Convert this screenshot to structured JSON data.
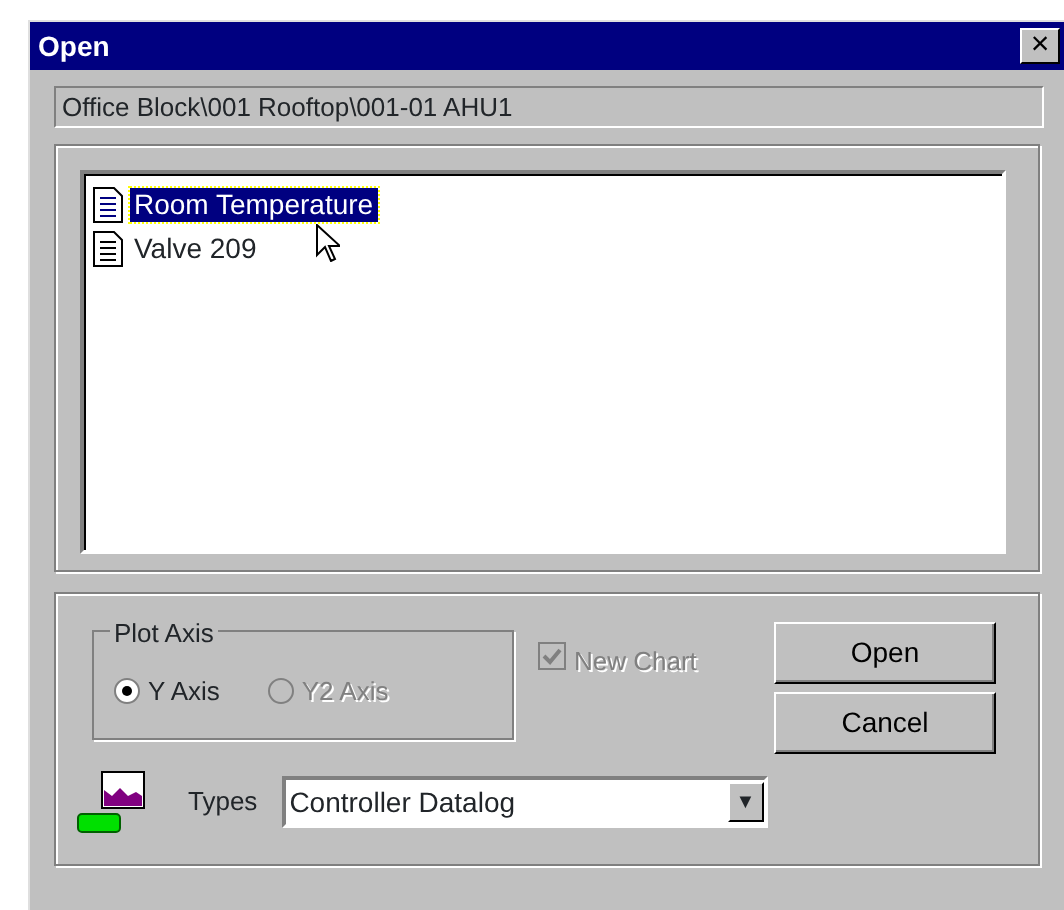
{
  "window": {
    "title": "Open",
    "close": "×"
  },
  "path": "Office Block\\001 Rooftop\\001-01 AHU1",
  "items": [
    {
      "label": "Room Temperature",
      "selected": true
    },
    {
      "label": "Valve 209",
      "selected": false
    }
  ],
  "plot_axis": {
    "title": "Plot Axis",
    "options": [
      {
        "label": "Y Axis",
        "selected": true,
        "disabled": false
      },
      {
        "label": "Y2 Axis",
        "selected": false,
        "disabled": true
      }
    ]
  },
  "new_chart": {
    "label": "New Chart",
    "checked": true,
    "disabled": true
  },
  "buttons": [
    "Open",
    "Cancel"
  ],
  "types": {
    "label": "Types",
    "value": "Controller Datalog",
    "arrow": "▼"
  }
}
